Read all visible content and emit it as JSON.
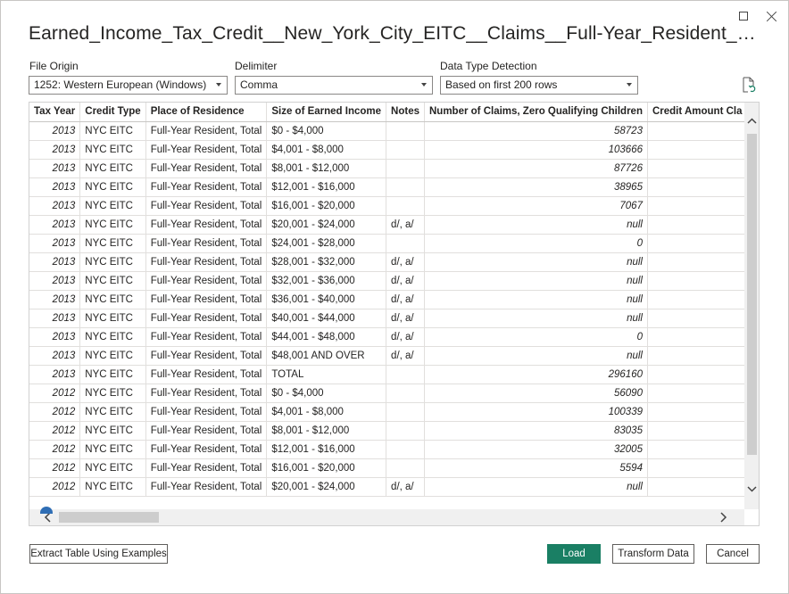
{
  "title": "Earned_Income_Tax_Credit__New_York_City_EITC__Claims__Full-Year_Resident_Totals__by…",
  "window": {
    "maximize_icon": "maximize-icon",
    "close_icon": "close-icon"
  },
  "file_origin": {
    "label": "File Origin",
    "value": "1252: Western European (Windows)"
  },
  "delimiter": {
    "label": "Delimiter",
    "value": "Comma"
  },
  "data_type_detection": {
    "label": "Data Type Detection",
    "value": "Based on first 200 rows"
  },
  "refresh_icon": "refresh-document-icon",
  "table": {
    "columns": [
      "Tax Year",
      "Credit Type",
      "Place of Residence",
      "Size of Earned Income",
      "Notes",
      "Number of Claims, Zero Qualifying Children",
      "Credit Amount Cla"
    ],
    "rows": [
      [
        "2013",
        "NYC EITC",
        "Full-Year Resident, Total",
        "$0 - $4,000",
        "",
        "58723",
        ""
      ],
      [
        "2013",
        "NYC EITC",
        "Full-Year Resident, Total",
        "$4,001 - $8,000",
        "",
        "103666",
        ""
      ],
      [
        "2013",
        "NYC EITC",
        "Full-Year Resident, Total",
        "$8,001 - $12,000",
        "",
        "87726",
        ""
      ],
      [
        "2013",
        "NYC EITC",
        "Full-Year Resident, Total",
        "$12,001 - $16,000",
        "",
        "38965",
        ""
      ],
      [
        "2013",
        "NYC EITC",
        "Full-Year Resident, Total",
        "$16,001 - $20,000",
        "",
        "7067",
        ""
      ],
      [
        "2013",
        "NYC EITC",
        "Full-Year Resident, Total",
        "$20,001 - $24,000",
        "d/, a/",
        "null",
        ""
      ],
      [
        "2013",
        "NYC EITC",
        "Full-Year Resident, Total",
        "$24,001 - $28,000",
        "",
        "0",
        ""
      ],
      [
        "2013",
        "NYC EITC",
        "Full-Year Resident, Total",
        "$28,001 - $32,000",
        "d/, a/",
        "null",
        ""
      ],
      [
        "2013",
        "NYC EITC",
        "Full-Year Resident, Total",
        "$32,001 - $36,000",
        "d/, a/",
        "null",
        ""
      ],
      [
        "2013",
        "NYC EITC",
        "Full-Year Resident, Total",
        "$36,001 - $40,000",
        "d/, a/",
        "null",
        ""
      ],
      [
        "2013",
        "NYC EITC",
        "Full-Year Resident, Total",
        "$40,001 - $44,000",
        "d/, a/",
        "null",
        ""
      ],
      [
        "2013",
        "NYC EITC",
        "Full-Year Resident, Total",
        "$44,001 - $48,000",
        "d/, a/",
        "0",
        ""
      ],
      [
        "2013",
        "NYC EITC",
        "Full-Year Resident, Total",
        "$48,001 AND OVER",
        "d/, a/",
        "null",
        ""
      ],
      [
        "2013",
        "NYC EITC",
        "Full-Year Resident, Total",
        "TOTAL",
        "",
        "296160",
        ""
      ],
      [
        "2012",
        "NYC EITC",
        "Full-Year Resident, Total",
        "$0 - $4,000",
        "",
        "56090",
        ""
      ],
      [
        "2012",
        "NYC EITC",
        "Full-Year Resident, Total",
        "$4,001 - $8,000",
        "",
        "100339",
        ""
      ],
      [
        "2012",
        "NYC EITC",
        "Full-Year Resident, Total",
        "$8,001 - $12,000",
        "",
        "83035",
        ""
      ],
      [
        "2012",
        "NYC EITC",
        "Full-Year Resident, Total",
        "$12,001 - $16,000",
        "",
        "32005",
        ""
      ],
      [
        "2012",
        "NYC EITC",
        "Full-Year Resident, Total",
        "$16,001 - $20,000",
        "",
        "5594",
        ""
      ],
      [
        "2012",
        "NYC EITC",
        "Full-Year Resident, Total",
        "$20,001 - $24,000",
        "d/, a/",
        "null",
        ""
      ]
    ]
  },
  "buttons": {
    "extract": "Extract Table Using Examples",
    "load": "Load",
    "transform": "Transform Data",
    "cancel": "Cancel"
  },
  "colors": {
    "primary": "#1a7f64",
    "border": "#8a8886"
  }
}
